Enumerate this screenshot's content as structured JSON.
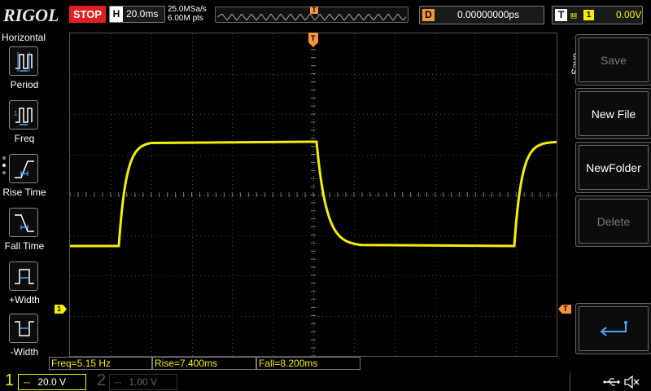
{
  "topbar": {
    "logo": "RIGOL",
    "run_state": "STOP",
    "horizontal_key": "H",
    "timebase": "20.0ms",
    "sample_rate": "25.0MSa/s",
    "memory_depth": "6.00M pts",
    "trigger_marker": "T",
    "delay_key": "D",
    "delay_value": "0.00000000ps",
    "trigger_key": "T",
    "trigger_source": "1",
    "trigger_level": "0.00V"
  },
  "left_menu": {
    "title": "Horizontal",
    "items": [
      {
        "label": "Period",
        "icon": "period-icon"
      },
      {
        "label": "Freq",
        "icon": "freq-icon"
      },
      {
        "label": "Rise Time",
        "icon": "rise-time-icon"
      },
      {
        "label": "Fall Time",
        "icon": "fall-time-icon"
      },
      {
        "label": "+Width",
        "icon": "positive-width-icon"
      },
      {
        "label": "-Width",
        "icon": "negative-width-icon"
      }
    ]
  },
  "measurements": {
    "freq": "Freq=5.15 Hz",
    "rise": "Rise=7.400ms",
    "fall": "Fall=8.200ms"
  },
  "markers": {
    "ch1_ground": "1",
    "trigger_level": "T"
  },
  "right_menu": {
    "title": "Save",
    "items": [
      {
        "label": "Save",
        "enabled": false
      },
      {
        "label": "New File",
        "enabled": true
      },
      {
        "label": "NewFolder",
        "enabled": true
      },
      {
        "label": "Delete",
        "enabled": false
      },
      {
        "label": "",
        "icon": "return-arrow-icon",
        "enabled": true
      }
    ]
  },
  "channels": {
    "ch1": {
      "number": "1",
      "scale": "20.0 V",
      "coupling": "dc-icon",
      "color": "#f5ee00"
    },
    "ch2": {
      "number": "2",
      "scale": "1.00 V",
      "coupling": "dc-icon",
      "color": "#555555"
    }
  },
  "status_icons": [
    "usb-icon",
    "speaker-muted-icon"
  ],
  "colors": {
    "ch1": "#f5ee00",
    "trigger": "#f7943c",
    "stop": "#e02020"
  }
}
